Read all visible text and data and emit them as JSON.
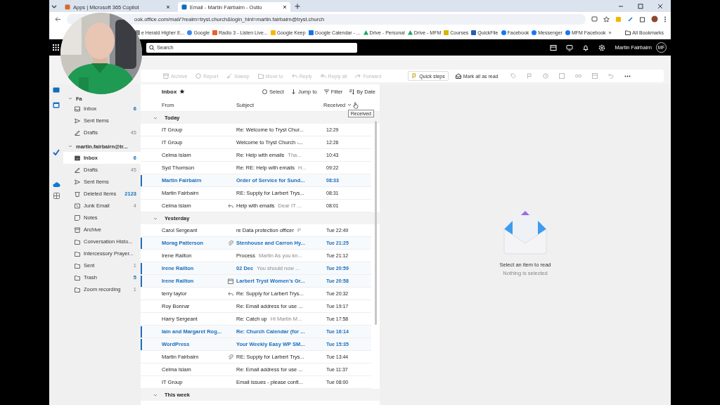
{
  "browser": {
    "tabs": [
      {
        "title": "Apps | Microsoft 365 Copilot",
        "selected": false
      },
      {
        "title": "Email - Martin Fairbairn - Outlo",
        "selected": true
      }
    ],
    "address": "ook.office.com/mail/?realm=tryst.church&login_hint=martin.fairbairn@tryst.church",
    "bookmarks": [
      {
        "label": "e Herald Higher E..."
      },
      {
        "label": "Google"
      },
      {
        "label": "Radio 3 - Listen Live..."
      },
      {
        "label": "Google Keep"
      },
      {
        "label": "Google Calendar - ..."
      },
      {
        "label": "Drive - Personal"
      },
      {
        "label": "Drive - MFM"
      },
      {
        "label": "Courses"
      },
      {
        "label": "QuickFile"
      },
      {
        "label": "Facebook"
      },
      {
        "label": "Messenger"
      },
      {
        "label": "MFM Facebook"
      }
    ],
    "bookmarks_more": "»",
    "all_bookmarks": "All Bookmarks"
  },
  "header": {
    "search": {
      "placeholder": "Search"
    },
    "user": {
      "name": "Martin Fairbairn",
      "initials": "MF"
    }
  },
  "toolbar": [
    {
      "label": "Archive",
      "disabled": true
    },
    {
      "label": "Report",
      "disabled": true
    },
    {
      "label": "Sweep",
      "disabled": true
    },
    {
      "label": "Move to",
      "disabled": true
    },
    {
      "label": "Reply",
      "disabled": true
    },
    {
      "label": "Reply all",
      "disabled": true
    },
    {
      "label": "Forward",
      "disabled": true
    },
    {
      "label": "Quick steps",
      "disabled": false
    },
    {
      "label": "Mark all as read",
      "disabled": false
    }
  ],
  "folders": {
    "favorites": {
      "label": "Fa",
      "items": [
        {
          "name": "Inbox",
          "kind": "inbox",
          "count": "6",
          "unread": true,
          "selected": false
        },
        {
          "name": "Sent Items",
          "kind": "sent",
          "selected": false
        },
        {
          "name": "Drafts",
          "kind": "drafts",
          "count": "45",
          "unread": false,
          "selected": false
        }
      ]
    },
    "account": {
      "label": "martin.fairbairn@tr...",
      "items": [
        {
          "name": "Inbox",
          "kind": "inbox",
          "count": "6",
          "unread": true,
          "selected": true
        },
        {
          "name": "Drafts",
          "kind": "drafts",
          "count": "45",
          "unread": false,
          "selected": false
        },
        {
          "name": "Sent Items",
          "kind": "sent",
          "selected": false
        },
        {
          "name": "Deleted Items",
          "kind": "deleted",
          "count": "2123",
          "unread": true,
          "selected": false
        },
        {
          "name": "Junk Email",
          "kind": "junk",
          "count": "4",
          "unread": false,
          "selected": false
        },
        {
          "name": "Notes",
          "kind": "notes",
          "selected": false
        },
        {
          "name": "Archive",
          "kind": "archive",
          "selected": false
        },
        {
          "name": "Conversation Histo...",
          "kind": "folder",
          "selected": false
        },
        {
          "name": "Intercessory Prayer...",
          "kind": "folder",
          "selected": false
        },
        {
          "name": "Sent",
          "kind": "folder",
          "count": "1",
          "unread": false,
          "selected": false
        },
        {
          "name": "Trash",
          "kind": "folder",
          "count": "5",
          "unread": true,
          "selected": false
        },
        {
          "name": "Zoom recording",
          "kind": "folder",
          "count": "1",
          "unread": false,
          "selected": false
        }
      ]
    }
  },
  "message_list": {
    "title": "Inbox",
    "actions": [
      "Select",
      "Jump to",
      "Filter",
      "By Date"
    ],
    "columns": [
      "From",
      "Subject",
      "Received"
    ],
    "tooltip": "Received",
    "groups": [
      {
        "label": "Today",
        "rows": [
          {
            "kind": "plain",
            "from": "IT Group",
            "subject": "Re: Welcome to Tryst Chur...",
            "time": "12:29",
            "unread": false
          },
          {
            "kind": "plain",
            "from": "IT Group",
            "subject": "Welcome to Tryst Church -...",
            "time": "12:26",
            "unread": false
          },
          {
            "kind": "plain",
            "from": "Celma Islam",
            "subject": "Re: Help with emails",
            "preview": "Tha...",
            "time": "10:43",
            "unread": false
          },
          {
            "kind": "plain",
            "from": "Syd Thomson",
            "subject": "Re: RE: Help with emails",
            "preview": "H...",
            "time": "09:22",
            "unread": false
          },
          {
            "kind": "plain",
            "from": "Martin Fairbairn",
            "subject": "Order of Service for Sund...",
            "time": "08:33",
            "unread": true
          },
          {
            "kind": "plain",
            "from": "Martin Fairbairn",
            "subject": "RE: Supply for Larbert Trys...",
            "time": "08:31",
            "unread": false
          },
          {
            "kind": "reply",
            "from": "Celma Islam",
            "subject": "Help with emails",
            "preview": "Dear IT ...",
            "time": "08:01",
            "unread": false
          }
        ]
      },
      {
        "label": "Yesterday",
        "rows": [
          {
            "kind": "plain",
            "from": "Carol Sergeant",
            "subject": "re Data protection officer",
            "preview": "P",
            "time": "Tue 22:49",
            "unread": false
          },
          {
            "kind": "attachment",
            "from": "Morag Patterson",
            "subject": "Stenhouse and Carron Hy...",
            "time": "Tue 21:25",
            "unread": true
          },
          {
            "kind": "plain",
            "from": "Irene Railton",
            "subject": "Process",
            "preview": "Martin As you kn...",
            "time": "Tue 21:12",
            "unread": false
          },
          {
            "kind": "plain",
            "from": "Irene Railton",
            "subject": "02 Dec",
            "preview": "You should now ...",
            "time": "Tue 20:59",
            "unread": true
          },
          {
            "kind": "calendar",
            "from": "Irene Railton",
            "subject": "Larbert Tryst Women's Gr...",
            "time": "Tue 20:58",
            "unread": true
          },
          {
            "kind": "reply",
            "from": "terry taylor",
            "subject": "Re: Supply for Larbert Trys...",
            "time": "Tue 20:32",
            "unread": false
          },
          {
            "kind": "plain",
            "from": "Roy Bonnar",
            "subject": "Re: Email address for use ...",
            "time": "Tue 19:17",
            "unread": false
          },
          {
            "kind": "plain",
            "from": "Harry Sergeant",
            "subject": "Re: Catch up",
            "preview": "Hi Martin M...",
            "time": "Tue 17:58",
            "unread": false
          },
          {
            "kind": "plain",
            "from": "Iain and Margaret Rog...",
            "subject": "Re: Church Calendar (for ...",
            "time": "Tue 16:14",
            "unread": true
          },
          {
            "kind": "plain",
            "from": "WordPress",
            "subject": "Your Weekly Easy WP SM...",
            "time": "Tue 15:35",
            "unread": true
          },
          {
            "kind": "attachment",
            "from": "Martin Fairbairn",
            "subject": "RE: Supply for Larbert Trys...",
            "time": "Tue 13:44",
            "unread": false
          },
          {
            "kind": "plain",
            "from": "Celma Islam",
            "subject": "Re: Email address for use ...",
            "time": "Tue 11:37",
            "unread": false
          },
          {
            "kind": "plain",
            "from": "IT Group",
            "subject": "Email issues - please confi...",
            "time": "Tue 08:00",
            "unread": false
          }
        ]
      },
      {
        "label": "This week"
      }
    ]
  },
  "reading_pane": {
    "title": "Select an item to read",
    "subtitle": "Nothing is selected"
  }
}
